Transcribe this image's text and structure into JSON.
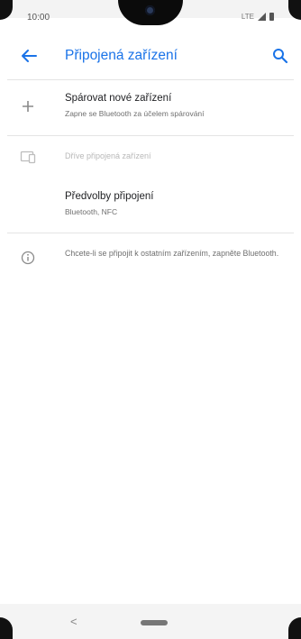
{
  "status_bar": {
    "time": "10:00",
    "network": "LTE"
  },
  "app_bar": {
    "title": "Připojená zařízení"
  },
  "pair_new": {
    "title": "Spárovat nové zařízení",
    "subtitle": "Zapne se Bluetooth za účelem spárování"
  },
  "previously_connected": {
    "label": "Dříve připojená zařízení"
  },
  "connection_prefs": {
    "title": "Předvolby připojení",
    "subtitle": "Bluetooth, NFC"
  },
  "info": {
    "text": "Chcete-li se připojit k ostatním zařízením, zapněte Bluetooth."
  },
  "nav_bar": {
    "back_glyph": "<"
  },
  "colors": {
    "accent": "#1a73e8",
    "text_primary": "#202124",
    "text_secondary": "#6f6f6f",
    "text_disabled": "#b8b8b8"
  }
}
